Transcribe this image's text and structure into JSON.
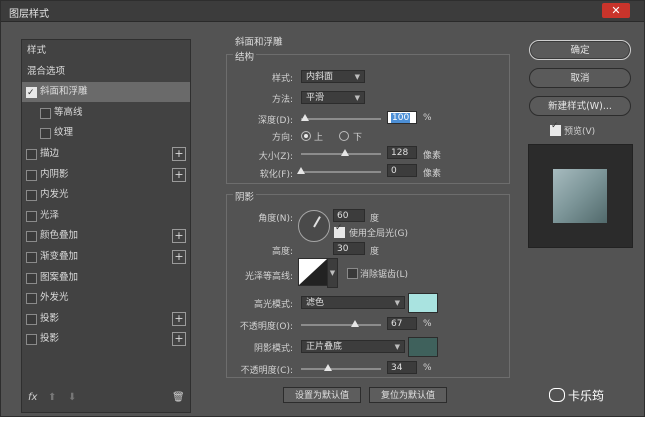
{
  "window": {
    "title": "图层样式",
    "close_glyph": "✕"
  },
  "left_panel": {
    "items": [
      {
        "label": "样式",
        "checkbox": false,
        "plus": false,
        "indent": 0
      },
      {
        "label": "混合选项",
        "checkbox": false,
        "plus": false,
        "indent": 0
      },
      {
        "label": "斜面和浮雕",
        "checkbox": true,
        "checked": true,
        "plus": false,
        "indent": 0,
        "selected": true
      },
      {
        "label": "等高线",
        "checkbox": true,
        "checked": false,
        "plus": false,
        "indent": 1
      },
      {
        "label": "纹理",
        "checkbox": true,
        "checked": false,
        "plus": false,
        "indent": 1
      },
      {
        "label": "描边",
        "checkbox": true,
        "checked": false,
        "plus": true,
        "indent": 0
      },
      {
        "label": "内阴影",
        "checkbox": true,
        "checked": false,
        "plus": true,
        "indent": 0
      },
      {
        "label": "内发光",
        "checkbox": true,
        "checked": false,
        "plus": false,
        "indent": 0
      },
      {
        "label": "光泽",
        "checkbox": true,
        "checked": false,
        "plus": false,
        "indent": 0
      },
      {
        "label": "颜色叠加",
        "checkbox": true,
        "checked": false,
        "plus": true,
        "indent": 0
      },
      {
        "label": "渐变叠加",
        "checkbox": true,
        "checked": false,
        "plus": true,
        "indent": 0
      },
      {
        "label": "图案叠加",
        "checkbox": true,
        "checked": false,
        "plus": false,
        "indent": 0
      },
      {
        "label": "外发光",
        "checkbox": true,
        "checked": false,
        "plus": false,
        "indent": 0
      },
      {
        "label": "投影",
        "checkbox": true,
        "checked": false,
        "plus": true,
        "indent": 0
      },
      {
        "label": "投影",
        "checkbox": true,
        "checked": false,
        "plus": true,
        "indent": 0
      }
    ],
    "fx": "fx",
    "up": "⬆",
    "down": "⬇",
    "trash": "🗑"
  },
  "bevel": {
    "group_title": "斜面和浮雕",
    "structure_title": "结构",
    "style_label": "样式:",
    "style_value": "内斜面",
    "method_label": "方法:",
    "method_value": "平滑",
    "depth_label": "深度(D):",
    "depth_value": "100",
    "depth_unit": "%",
    "direction_label": "方向:",
    "dir_up": "上",
    "dir_down": "下",
    "size_label": "大小(Z):",
    "size_value": "128",
    "size_unit": "像素",
    "soften_label": "软化(F):",
    "soften_value": "0",
    "soften_unit": "像素",
    "depth_level": 0.05,
    "size_level": 0.55,
    "soften_level": 0.0
  },
  "shading": {
    "title": "阴影",
    "angle_label": "角度(N):",
    "angle_value": "60",
    "angle_unit": "度",
    "global_light_label": "使用全局光(G)",
    "altitude_label": "高度:",
    "altitude_value": "30",
    "altitude_unit": "度",
    "gloss_label": "光泽等高线:",
    "anti_alias_label": "消除锯齿(L)",
    "highlight_mode_label": "高光模式:",
    "highlight_mode_value": "滤色",
    "highlight_color": "#a9e3e0",
    "opacity1_label": "不透明度(O):",
    "opacity1_value": "67",
    "opacity1_unit": "%",
    "opacity1_level": 0.67,
    "shadow_mode_label": "阴影模式:",
    "shadow_mode_value": "正片叠底",
    "shadow_color": "#3f615c",
    "opacity2_label": "不透明度(C):",
    "opacity2_value": "34",
    "opacity2_unit": "%",
    "opacity2_level": 0.34
  },
  "footer_buttons": {
    "set_default": "设置为默认值",
    "reset_default": "复位为默认值"
  },
  "right": {
    "ok": "确定",
    "cancel": "取消",
    "new_style": "新建样式(W)...",
    "preview_label": "预览(V)"
  },
  "watermark": "卡乐筠"
}
